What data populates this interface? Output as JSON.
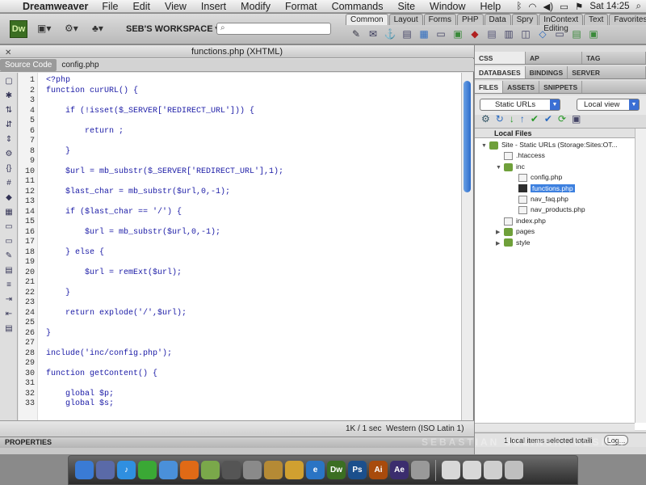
{
  "menubar": {
    "app_name": "Dreamweaver",
    "items": [
      "File",
      "Edit",
      "View",
      "Insert",
      "Modify",
      "Format",
      "Commands",
      "Site",
      "Window",
      "Help"
    ],
    "clock": "Sat 14:25"
  },
  "toolbar": {
    "logo": "Dw",
    "workspace": "SEB'S WORKSPACE",
    "search_placeholder": ""
  },
  "insert_panel": {
    "tabs": [
      "Common",
      "Layout",
      "Forms",
      "PHP",
      "Data",
      "Spry",
      "InContext Editing",
      "Text",
      "Favorites"
    ],
    "active_tab": "Common"
  },
  "document": {
    "title": "functions.php (XHTML)",
    "tabs": [
      "Source Code",
      "config.php"
    ],
    "active_tab": "Source Code",
    "lines": [
      {
        "n": "1",
        "t": "<?php"
      },
      {
        "n": "2",
        "t": "function curURL() {"
      },
      {
        "n": "3",
        "t": ""
      },
      {
        "n": "4",
        "t": "    if (!isset($_SERVER['REDIRECT_URL'])) {"
      },
      {
        "n": "5",
        "t": ""
      },
      {
        "n": "6",
        "t": "        return ;"
      },
      {
        "n": "7",
        "t": ""
      },
      {
        "n": "8",
        "t": "    }"
      },
      {
        "n": "9",
        "t": ""
      },
      {
        "n": "10",
        "t": "    $url = mb_substr($_SERVER['REDIRECT_URL'],1);"
      },
      {
        "n": "11",
        "t": ""
      },
      {
        "n": "12",
        "t": "    $last_char = mb_substr($url,0,-1);"
      },
      {
        "n": "13",
        "t": ""
      },
      {
        "n": "14",
        "t": "    if ($last_char == '/') {"
      },
      {
        "n": "15",
        "t": ""
      },
      {
        "n": "16",
        "t": "        $url = mb_substr($url,0,-1);"
      },
      {
        "n": "17",
        "t": ""
      },
      {
        "n": "18",
        "t": "    } else {"
      },
      {
        "n": "19",
        "t": ""
      },
      {
        "n": "20",
        "t": "        $url = remExt($url);"
      },
      {
        "n": "21",
        "t": ""
      },
      {
        "n": "22",
        "t": "    }"
      },
      {
        "n": "23",
        "t": ""
      },
      {
        "n": "24",
        "t": "    return explode('/',$url);"
      },
      {
        "n": "25",
        "t": ""
      },
      {
        "n": "26",
        "t": "}"
      },
      {
        "n": "27",
        "t": ""
      },
      {
        "n": "28",
        "t": "include('inc/config.php');"
      },
      {
        "n": "29",
        "t": ""
      },
      {
        "n": "30",
        "t": "function getContent() {"
      },
      {
        "n": "31",
        "t": ""
      },
      {
        "n": "32",
        "t": "    global $p;"
      },
      {
        "n": "33",
        "t": "    global $s;"
      }
    ],
    "status_size": "1K / 1 sec",
    "status_encoding": "Western (ISO Latin 1)"
  },
  "properties": {
    "label": "PROPERTIES"
  },
  "panels": {
    "group1_tabs": [
      "CSS STYLES",
      "AP ELEMENTS",
      "TAG INSPECTOR"
    ],
    "group2_tabs": [
      "DATABASES",
      "BINDINGS",
      "SERVER BEHAVIORS"
    ],
    "group3_tabs": [
      "FILES",
      "ASSETS",
      "SNIPPETS"
    ],
    "site_select": "Static URLs",
    "view_select": "Local view",
    "tree_header": "Local Files",
    "tree": [
      {
        "label": "Site - Static URLs (Storage:Sites:OT...",
        "type": "folder",
        "depth": 0,
        "tri": "▼"
      },
      {
        "label": ".htaccess",
        "type": "file",
        "depth": 1,
        "tri": ""
      },
      {
        "label": "inc",
        "type": "folder",
        "depth": 1,
        "tri": "▼"
      },
      {
        "label": "config.php",
        "type": "file",
        "depth": 2,
        "tri": ""
      },
      {
        "label": "functions.php",
        "type": "sel",
        "depth": 2,
        "tri": ""
      },
      {
        "label": "nav_faq.php",
        "type": "file",
        "depth": 2,
        "tri": ""
      },
      {
        "label": "nav_products.php",
        "type": "file",
        "depth": 2,
        "tri": ""
      },
      {
        "label": "index.php",
        "type": "file",
        "depth": 1,
        "tri": ""
      },
      {
        "label": "pages",
        "type": "folder",
        "depth": 1,
        "tri": "▶"
      },
      {
        "label": "style",
        "type": "folder",
        "depth": 1,
        "tri": "▶"
      }
    ],
    "status_text": "1 local items selected totalli",
    "log_button": "Log..."
  },
  "dock": {
    "icons": [
      {
        "name": "finder-icon",
        "label": "",
        "color": "#3a7bd5"
      },
      {
        "name": "xcode-icon",
        "label": "",
        "color": "#5a6aa8"
      },
      {
        "name": "itunes-icon",
        "label": "♪",
        "color": "#2f8fe0"
      },
      {
        "name": "spotify-icon",
        "label": "",
        "color": "#3aa835"
      },
      {
        "name": "safari-icon",
        "label": "",
        "color": "#4a90d9"
      },
      {
        "name": "firefox-icon",
        "label": "",
        "color": "#e06a16"
      },
      {
        "name": "coda-icon",
        "label": "",
        "color": "#7aa84a"
      },
      {
        "name": "time-machine-icon",
        "label": "",
        "color": "#555555"
      },
      {
        "name": "system-preferences-icon",
        "label": "",
        "color": "#8a8a8a"
      },
      {
        "name": "transmit-icon",
        "label": "",
        "color": "#b58a35"
      },
      {
        "name": "fetch-icon",
        "label": "",
        "color": "#d0a030"
      },
      {
        "name": "ie-icon",
        "label": "e",
        "color": "#2a74c4"
      },
      {
        "name": "dreamweaver-icon",
        "label": "Dw",
        "color": "#3b6e22"
      },
      {
        "name": "photoshop-icon",
        "label": "Ps",
        "color": "#1b4f8c"
      },
      {
        "name": "illustrator-icon",
        "label": "Ai",
        "color": "#a84b0c"
      },
      {
        "name": "after-effects-icon",
        "label": "Ae",
        "color": "#3b2d6e"
      },
      {
        "name": "xcode-tools-icon",
        "label": "",
        "color": "#999999"
      },
      {
        "name": "documents-stack-icon",
        "label": "",
        "color": "#d8d8d8"
      },
      {
        "name": "preview-stack-icon",
        "label": "",
        "color": "#d8d8d8"
      },
      {
        "name": "downloads-stack-icon",
        "label": "",
        "color": "#cfcfcf"
      },
      {
        "name": "trash-icon",
        "label": "",
        "color": "#bfbfbf"
      }
    ]
  },
  "watermark": "SEBASTIAN SULINSKI DESIGN"
}
